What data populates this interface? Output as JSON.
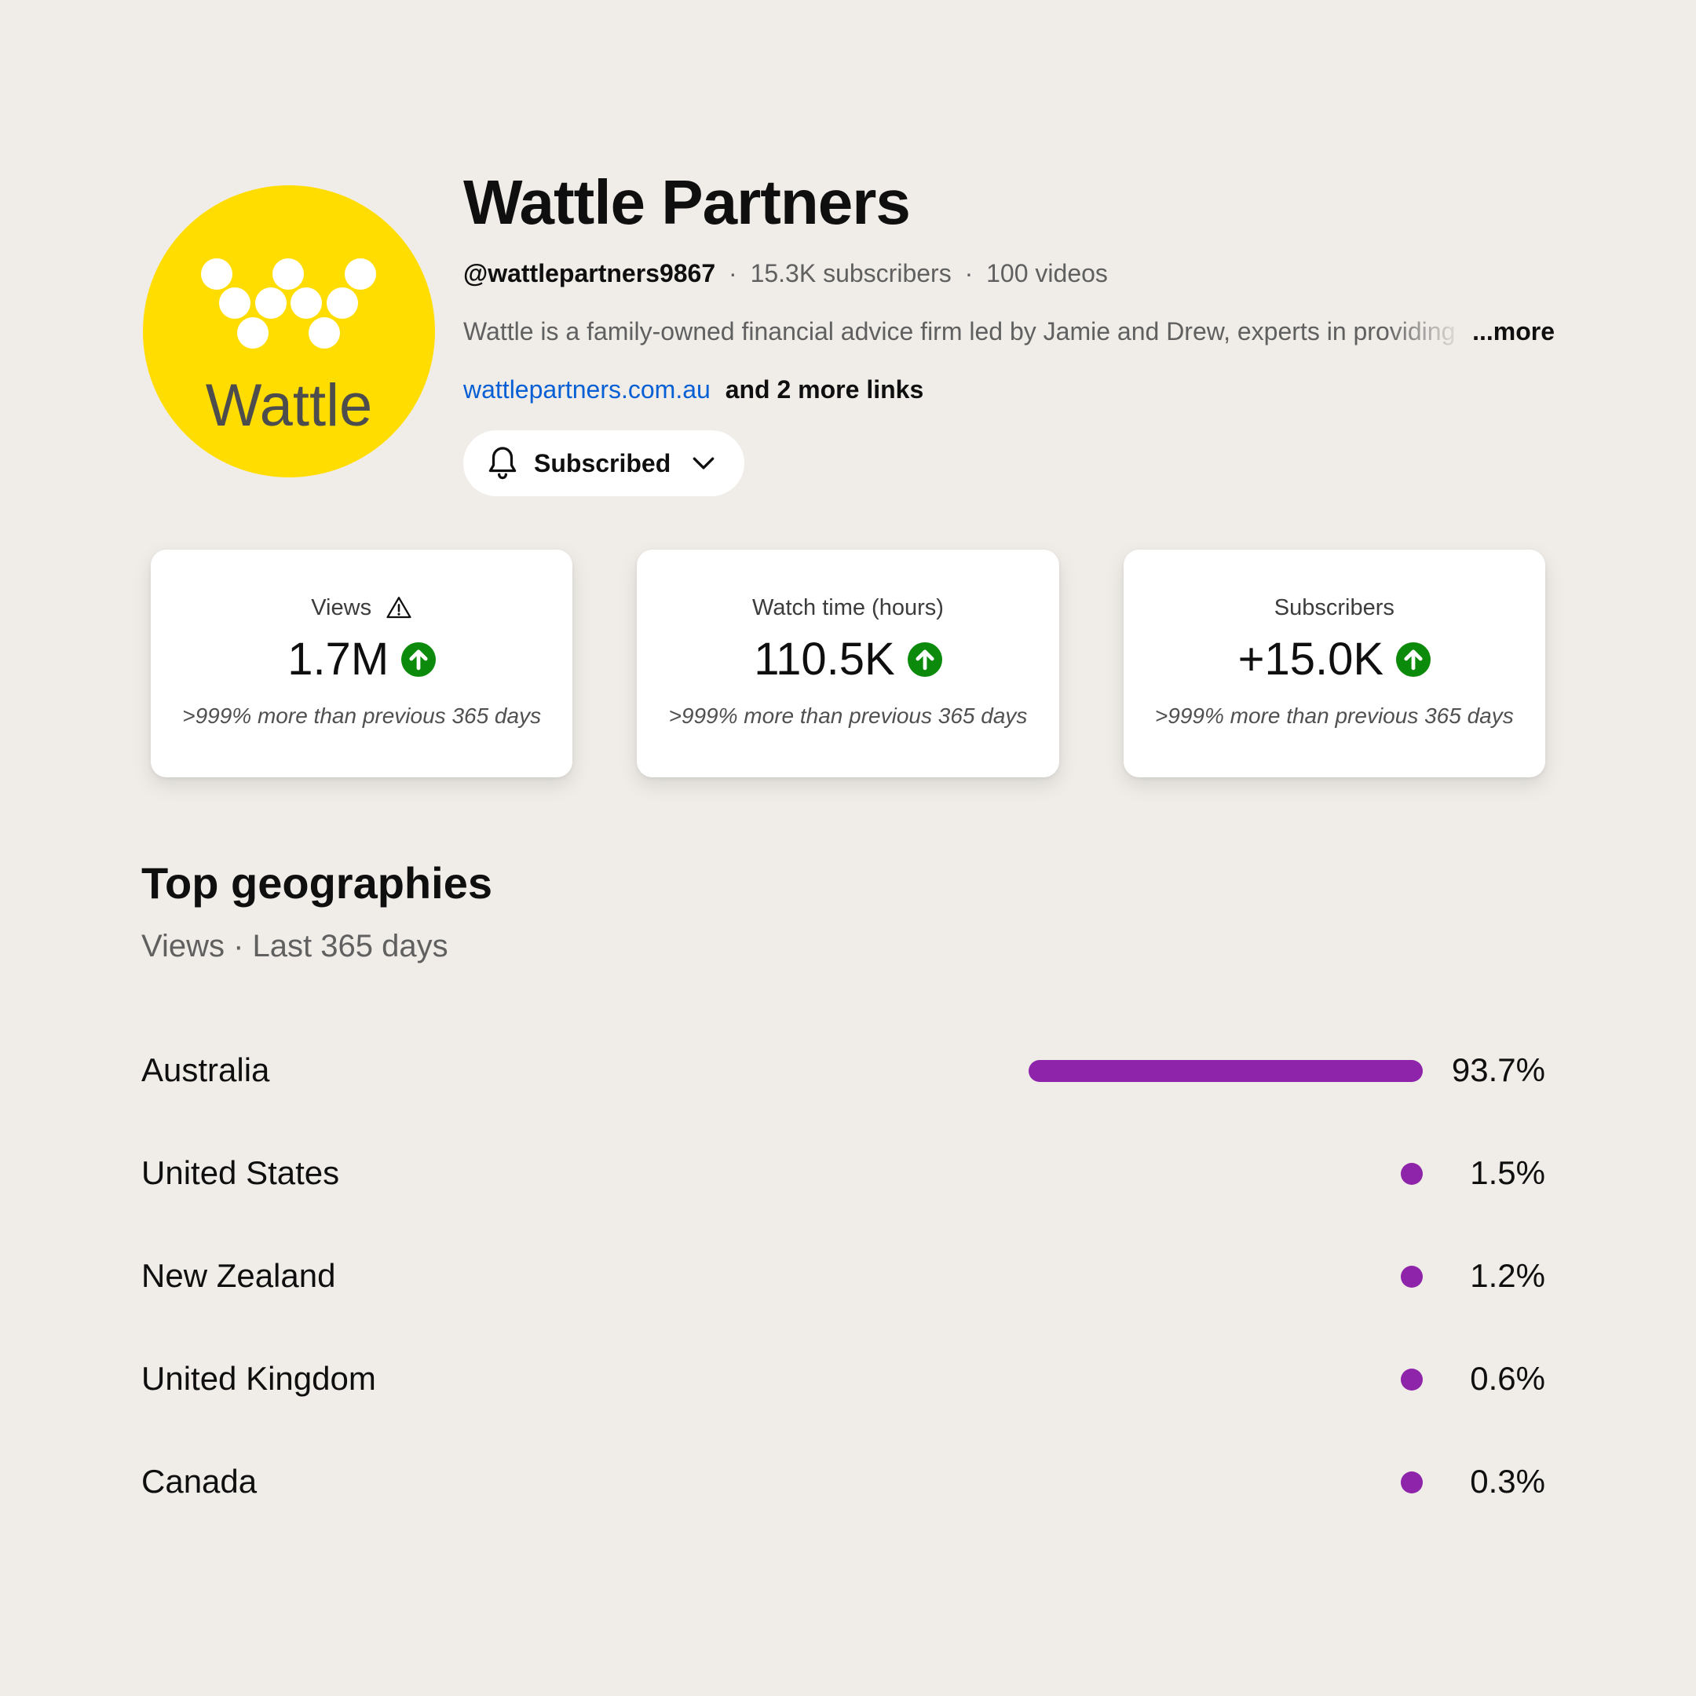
{
  "channel": {
    "avatar_wordmark": "Wattle",
    "name": "Wattle Partners",
    "handle": "@wattlepartners9867",
    "subscribers": "15.3K subscribers",
    "videos": "100 videos",
    "separator": "·",
    "description": "Wattle is a family-owned financial advice firm led by Jamie and Drew, experts in providing",
    "more_label": "...more",
    "link": "wattlepartners.com.au",
    "more_links": "and 2 more links",
    "subscribe_label": "Subscribed",
    "brand_color": "#ffdd00"
  },
  "metrics": [
    {
      "title": "Views",
      "value": "1.7M",
      "note": ">999% more than previous 365 days",
      "warning_icon": true,
      "trend_icon": "arrow-up-circle-icon"
    },
    {
      "title": "Watch time (hours)",
      "value": "110.5K",
      "note": ">999% more than previous 365 days",
      "warning_icon": false,
      "trend_icon": "arrow-up-circle-icon"
    },
    {
      "title": "Subscribers",
      "value": "+15.0K",
      "note": ">999% more than previous 365 days",
      "warning_icon": false,
      "trend_icon": "arrow-up-circle-icon"
    }
  ],
  "geographies": {
    "title": "Top geographies",
    "subtitle": "Views · Last 365 days",
    "bar_color": "#8e24aa",
    "rows": [
      {
        "country": "Australia",
        "percent_label": "93.7%",
        "value": 93.7
      },
      {
        "country": "United States",
        "percent_label": "1.5%",
        "value": 1.5
      },
      {
        "country": "New Zealand",
        "percent_label": "1.2%",
        "value": 1.2
      },
      {
        "country": "United Kingdom",
        "percent_label": "0.6%",
        "value": 0.6
      },
      {
        "country": "Canada",
        "percent_label": "0.3%",
        "value": 0.3
      }
    ]
  }
}
